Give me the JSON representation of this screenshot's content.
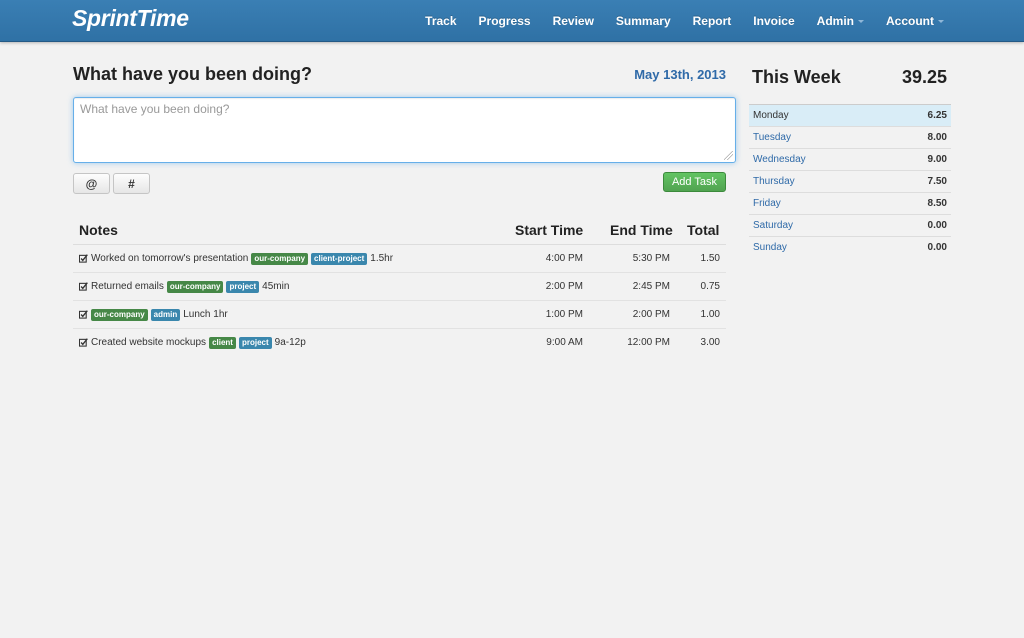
{
  "navbar": {
    "brand": "SprintTime",
    "items": [
      {
        "label": "Track"
      },
      {
        "label": "Progress"
      },
      {
        "label": "Review"
      },
      {
        "label": "Summary"
      },
      {
        "label": "Report"
      },
      {
        "label": "Invoice"
      },
      {
        "label": "Admin",
        "dropdown": true
      },
      {
        "label": "Account",
        "dropdown": true
      }
    ]
  },
  "entry": {
    "heading": "What have you been doing?",
    "date": "May 13th, 2013",
    "placeholder": "What have you been doing?",
    "value": "",
    "at_label": "@",
    "hash_label": "#",
    "add_label": "Add Task"
  },
  "tasks": {
    "headers": {
      "notes": "Notes",
      "start": "Start Time",
      "end": "End Time",
      "total": "Total"
    },
    "rows": [
      {
        "before": "Worked on tomorrow's presentation",
        "tags": [
          {
            "text": "our-company",
            "color": "green"
          },
          {
            "text": "client-project",
            "color": "blue"
          }
        ],
        "after": "1.5hr",
        "start": "4:00 PM",
        "end": "5:30 PM",
        "total": "1.50"
      },
      {
        "before": "Returned emails",
        "tags": [
          {
            "text": "our-company",
            "color": "green"
          },
          {
            "text": "project",
            "color": "blue"
          }
        ],
        "after": "45min",
        "start": "2:00 PM",
        "end": "2:45 PM",
        "total": "0.75"
      },
      {
        "before": "",
        "tags": [
          {
            "text": "our-company",
            "color": "green"
          },
          {
            "text": "admin",
            "color": "blue"
          }
        ],
        "after": "Lunch 1hr",
        "start": "1:00 PM",
        "end": "2:00 PM",
        "total": "1.00"
      },
      {
        "before": "Created website mockups",
        "tags": [
          {
            "text": "client",
            "color": "green"
          },
          {
            "text": "project",
            "color": "blue"
          }
        ],
        "after": "9a-12p",
        "start": "9:00 AM",
        "end": "12:00 PM",
        "total": "3.00"
      }
    ]
  },
  "week": {
    "title": "This Week",
    "total": "39.25",
    "days": [
      {
        "day": "Monday",
        "hours": "6.25",
        "active": true
      },
      {
        "day": "Tuesday",
        "hours": "8.00"
      },
      {
        "day": "Wednesday",
        "hours": "9.00"
      },
      {
        "day": "Thursday",
        "hours": "7.50"
      },
      {
        "day": "Friday",
        "hours": "8.50"
      },
      {
        "day": "Saturday",
        "hours": "0.00"
      },
      {
        "day": "Sunday",
        "hours": "0.00"
      }
    ]
  },
  "colors": {
    "navbar": "#3277ad",
    "tag_green": "#468847",
    "tag_blue": "#3a87ad",
    "add_button": "#51a351",
    "link": "#2f6aa8",
    "active_row": "#d9edf7"
  }
}
